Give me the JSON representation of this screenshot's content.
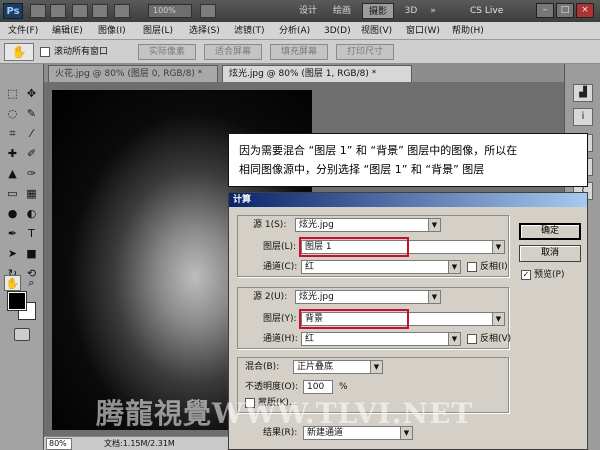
{
  "appbar": {
    "logo": "Ps",
    "zoom": "100%",
    "workspaces": [
      {
        "label": "设计",
        "active": false
      },
      {
        "label": "绘画",
        "active": false
      },
      {
        "label": "摄影",
        "active": true
      },
      {
        "label": "3D",
        "active": false
      }
    ],
    "overflow": "»",
    "cslive": "CS Live",
    "window_buttons": [
      "–",
      "□",
      "×"
    ]
  },
  "menubar": {
    "items": [
      "文件(F)",
      "编辑(E)",
      "图像(I)",
      "图层(L)",
      "选择(S)",
      "滤镜(T)",
      "分析(A)",
      "3D(D)",
      "视图(V)",
      "窗口(W)",
      "帮助(H)"
    ]
  },
  "options": {
    "tool_icon": "hand-icon",
    "scroll_all_label": "滚动所有窗口",
    "buttons": [
      "实际像素",
      "适合屏幕",
      "填充屏幕",
      "打印尺寸"
    ]
  },
  "doc_tabs": [
    {
      "label": "火花.jpg @ 80% (图层 0, RGB/8) *",
      "active": false
    },
    {
      "label": "炫光.jpg @ 80% (图层 1, RGB/8) *",
      "active": true
    }
  ],
  "status": {
    "zoom": "80%",
    "doc": "文档:1.15M/2.31M"
  },
  "callout": {
    "line1": "因为需要混合 “图层 1” 和 “背景” 图层中的图像，所以在",
    "line2": "相同图像源中，分别选择 “图层 1” 和 “背景” 图层"
  },
  "dialog": {
    "title": "计算",
    "source1": {
      "source_label": "源 1(S):",
      "source_value": "炫光.jpg",
      "layer_label": "图层(L):",
      "layer_value": "图层 1",
      "channel_label": "通道(C):",
      "channel_value": "红",
      "invert_label": "反相(I)"
    },
    "source2": {
      "source_label": "源 2(U):",
      "source_value": "炫光.jpg",
      "layer_label": "图层(Y):",
      "layer_value": "背景",
      "channel_label": "通道(H):",
      "channel_value": "红",
      "invert_label": "反相(V)"
    },
    "blending": {
      "mode_label": "混合(B):",
      "mode_value": "正片叠底",
      "opacity_label": "不透明度(O):",
      "opacity_value": "100",
      "opacity_unit": "%",
      "mask_label": "蒙版(K)..."
    },
    "result": {
      "label": "结果(R):",
      "value": "新建通道"
    },
    "ok_label": "确定",
    "cancel_label": "取消",
    "preview_label": "预览(P)",
    "preview_checked": "✓"
  },
  "watermark": "腾龍視覺WWW.TLVI.NET",
  "colors": {
    "highlight": "#c8102e",
    "title_bar": "#0a246a"
  }
}
